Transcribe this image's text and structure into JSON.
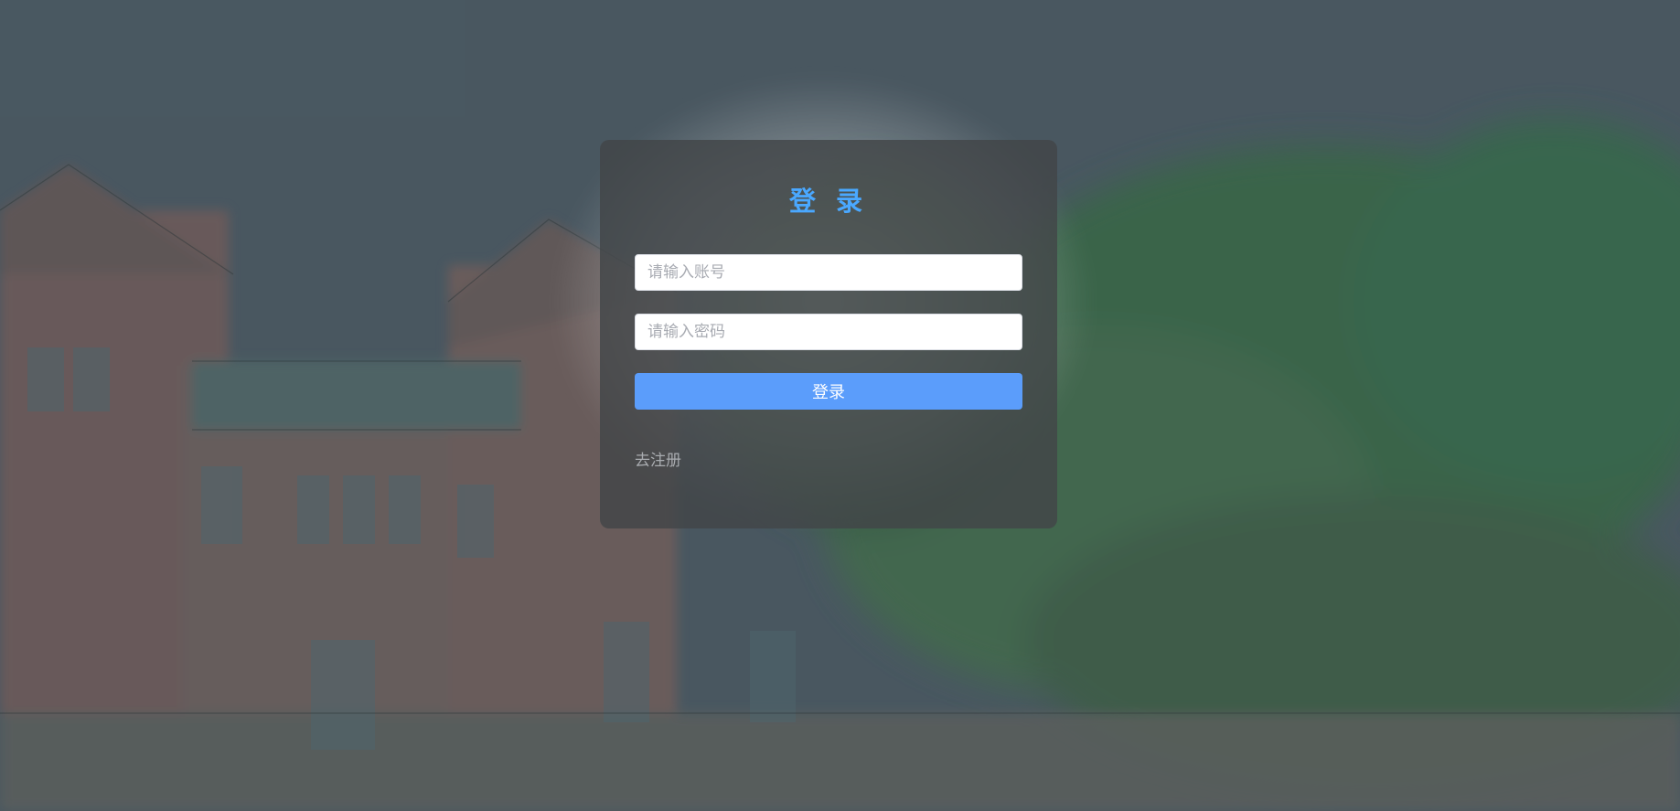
{
  "login": {
    "title": "登 录",
    "account_placeholder": "请输入账号",
    "password_placeholder": "请输入密码",
    "account_value": "",
    "password_value": "",
    "submit_label": "登录",
    "register_link": "去注册"
  },
  "colors": {
    "title": "#4aa8ff",
    "button": "#5b9dfb",
    "card": "#424648",
    "link": "#a9acb0"
  }
}
